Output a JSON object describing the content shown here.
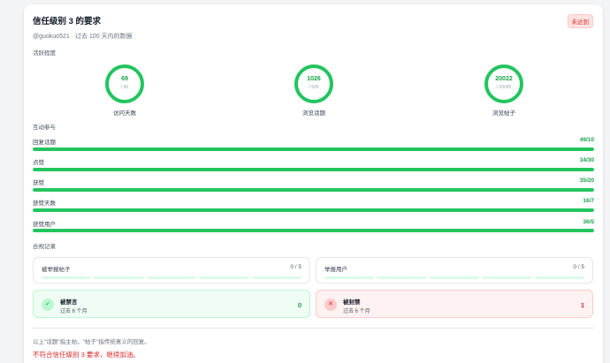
{
  "header": {
    "title": "信任级别 3 的要求",
    "status_badge": "未达到",
    "subtitle": "@guokuo521 · 过去 100 天内的数据"
  },
  "activity": {
    "label": "活跃程度",
    "rings": [
      {
        "value": "69",
        "required": "/ 50",
        "label": "访问天数",
        "progress": 1.0
      },
      {
        "value": "1026",
        "required": "/ 500",
        "label": "浏览话题",
        "progress": 1.0
      },
      {
        "value": "20022",
        "required": "/ 20000",
        "label": "浏览帖子",
        "progress": 1.0
      }
    ]
  },
  "engagement": {
    "label": "互动参与",
    "items": [
      {
        "label": "回复话题",
        "value": "49/10",
        "progress": 1.0
      },
      {
        "label": "点赞",
        "value": "34/30",
        "progress": 1.0
      },
      {
        "label": "获赞",
        "value": "35/20",
        "progress": 1.0
      },
      {
        "label": "获赞天数",
        "value": "16/7",
        "progress": 1.0
      },
      {
        "label": "获赞用户",
        "value": "36/5",
        "progress": 1.0
      }
    ]
  },
  "compliance": {
    "label": "合规记录",
    "flagged_posts": {
      "label": "被举报帖子",
      "count": "0 / 5",
      "segments": 5
    },
    "flagged_users": {
      "label": "举报用户",
      "count": "0 / 5",
      "segments": 5
    },
    "silenced": {
      "title": "被禁言",
      "sub": "过去 6 个月",
      "count": "0",
      "icon": "check-icon"
    },
    "suspended": {
      "title": "被封禁",
      "sub": "过去 6 个月",
      "count": "1",
      "icon": "x-icon"
    }
  },
  "footer": {
    "note": "以上\"话题\"指主帖，\"帖子\"指传统意义的回复。",
    "result": "不符合信任级别 3 要求，继续加油。"
  },
  "colors": {
    "green": "#22c55e",
    "green_light": "#dcfce7",
    "red": "#dc2626"
  }
}
